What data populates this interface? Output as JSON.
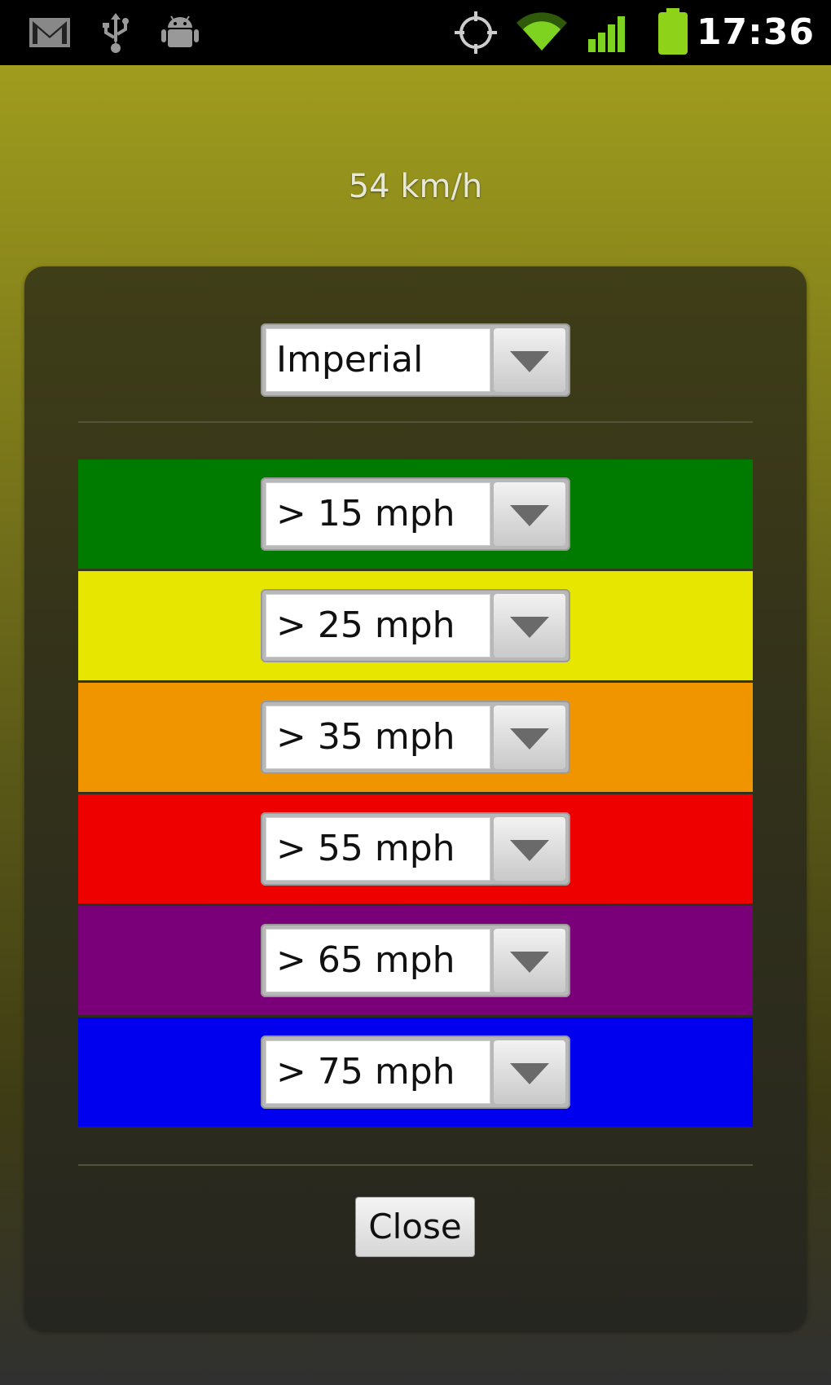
{
  "status_bar": {
    "time": "17:36",
    "icons": [
      "gmail-icon",
      "usb-icon",
      "android-debug-icon",
      "gps-icon",
      "wifi-icon",
      "signal-icon",
      "battery-icon"
    ],
    "colors": {
      "wifi": "#7ed321",
      "battery": "#8fd21a"
    }
  },
  "speed": {
    "text": "54 km/h"
  },
  "units_spinner": {
    "value": "Imperial"
  },
  "speed_thresholds": [
    {
      "label": "> 15 mph",
      "color": "#007b00"
    },
    {
      "label": "> 25 mph",
      "color": "#e6e600"
    },
    {
      "label": "> 35 mph",
      "color": "#f09400"
    },
    {
      "label": "> 55 mph",
      "color": "#ee0000"
    },
    {
      "label": "> 65 mph",
      "color": "#7a007a"
    },
    {
      "label": "> 75 mph",
      "color": "#0000ee"
    }
  ],
  "close_button": {
    "label": "Close"
  }
}
